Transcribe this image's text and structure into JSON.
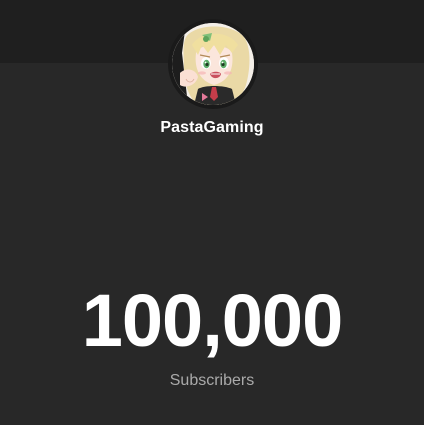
{
  "channel": {
    "name": "PastaGaming",
    "avatar_icon": "anime-avatar-icon"
  },
  "stats": {
    "subscriber_count": "100,000",
    "subscriber_label": "Subscribers"
  },
  "colors": {
    "background": "#282828",
    "top_band": "#1f1f1f",
    "primary_text": "#ffffff",
    "secondary_text": "#aaaaaa"
  }
}
